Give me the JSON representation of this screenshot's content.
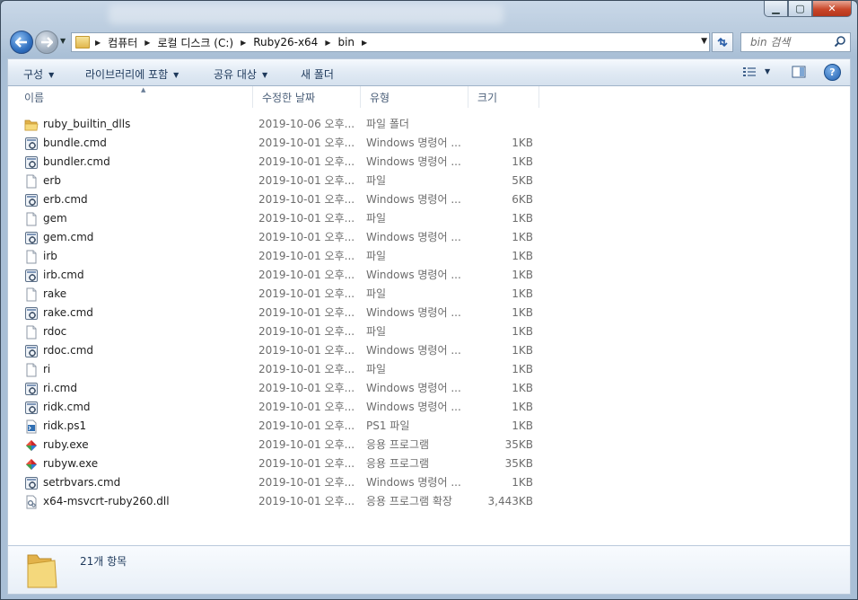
{
  "window": {
    "caption": {
      "minimize": "▁",
      "maximize": "▢",
      "close": "✕"
    }
  },
  "navigation": {
    "breadcrumbs": [
      "컴퓨터",
      "로컬 디스크 (C:)",
      "Ruby26-x64",
      "bin"
    ],
    "search_placeholder": "bin 검색"
  },
  "commandbar": {
    "organize": "구성",
    "include_in_library": "라이브러리에 포함",
    "share_with": "공유 대상",
    "new_folder": "새 폴더"
  },
  "columns": {
    "name": "이름",
    "date": "수정한 날짜",
    "type": "유형",
    "size": "크기"
  },
  "files": [
    {
      "name": "ruby_builtin_dlls",
      "date": "2019-10-06 오후...",
      "type": "파일 폴더",
      "size": "",
      "icon": "folder"
    },
    {
      "name": "bundle.cmd",
      "date": "2019-10-01 오후...",
      "type": "Windows 명령어 ...",
      "size": "1KB",
      "icon": "cmd"
    },
    {
      "name": "bundler.cmd",
      "date": "2019-10-01 오후...",
      "type": "Windows 명령어 ...",
      "size": "1KB",
      "icon": "cmd"
    },
    {
      "name": "erb",
      "date": "2019-10-01 오후...",
      "type": "파일",
      "size": "5KB",
      "icon": "file"
    },
    {
      "name": "erb.cmd",
      "date": "2019-10-01 오후...",
      "type": "Windows 명령어 ...",
      "size": "6KB",
      "icon": "cmd"
    },
    {
      "name": "gem",
      "date": "2019-10-01 오후...",
      "type": "파일",
      "size": "1KB",
      "icon": "file"
    },
    {
      "name": "gem.cmd",
      "date": "2019-10-01 오후...",
      "type": "Windows 명령어 ...",
      "size": "1KB",
      "icon": "cmd"
    },
    {
      "name": "irb",
      "date": "2019-10-01 오후...",
      "type": "파일",
      "size": "1KB",
      "icon": "file"
    },
    {
      "name": "irb.cmd",
      "date": "2019-10-01 오후...",
      "type": "Windows 명령어 ...",
      "size": "1KB",
      "icon": "cmd"
    },
    {
      "name": "rake",
      "date": "2019-10-01 오후...",
      "type": "파일",
      "size": "1KB",
      "icon": "file"
    },
    {
      "name": "rake.cmd",
      "date": "2019-10-01 오후...",
      "type": "Windows 명령어 ...",
      "size": "1KB",
      "icon": "cmd"
    },
    {
      "name": "rdoc",
      "date": "2019-10-01 오후...",
      "type": "파일",
      "size": "1KB",
      "icon": "file"
    },
    {
      "name": "rdoc.cmd",
      "date": "2019-10-01 오후...",
      "type": "Windows 명령어 ...",
      "size": "1KB",
      "icon": "cmd"
    },
    {
      "name": "ri",
      "date": "2019-10-01 오후...",
      "type": "파일",
      "size": "1KB",
      "icon": "file"
    },
    {
      "name": "ri.cmd",
      "date": "2019-10-01 오후...",
      "type": "Windows 명령어 ...",
      "size": "1KB",
      "icon": "cmd"
    },
    {
      "name": "ridk.cmd",
      "date": "2019-10-01 오후...",
      "type": "Windows 명령어 ...",
      "size": "1KB",
      "icon": "cmd"
    },
    {
      "name": "ridk.ps1",
      "date": "2019-10-01 오후...",
      "type": "PS1 파일",
      "size": "1KB",
      "icon": "ps1"
    },
    {
      "name": "ruby.exe",
      "date": "2019-10-01 오후...",
      "type": "응용 프로그램",
      "size": "35KB",
      "icon": "exe"
    },
    {
      "name": "rubyw.exe",
      "date": "2019-10-01 오후...",
      "type": "응용 프로그램",
      "size": "35KB",
      "icon": "exe"
    },
    {
      "name": "setrbvars.cmd",
      "date": "2019-10-01 오후...",
      "type": "Windows 명령어 ...",
      "size": "1KB",
      "icon": "cmd"
    },
    {
      "name": "x64-msvcrt-ruby260.dll",
      "date": "2019-10-01 오후...",
      "type": "응용 프로그램 확장",
      "size": "3,443KB",
      "icon": "dll"
    }
  ],
  "details": {
    "item_count": "21개 항목"
  }
}
